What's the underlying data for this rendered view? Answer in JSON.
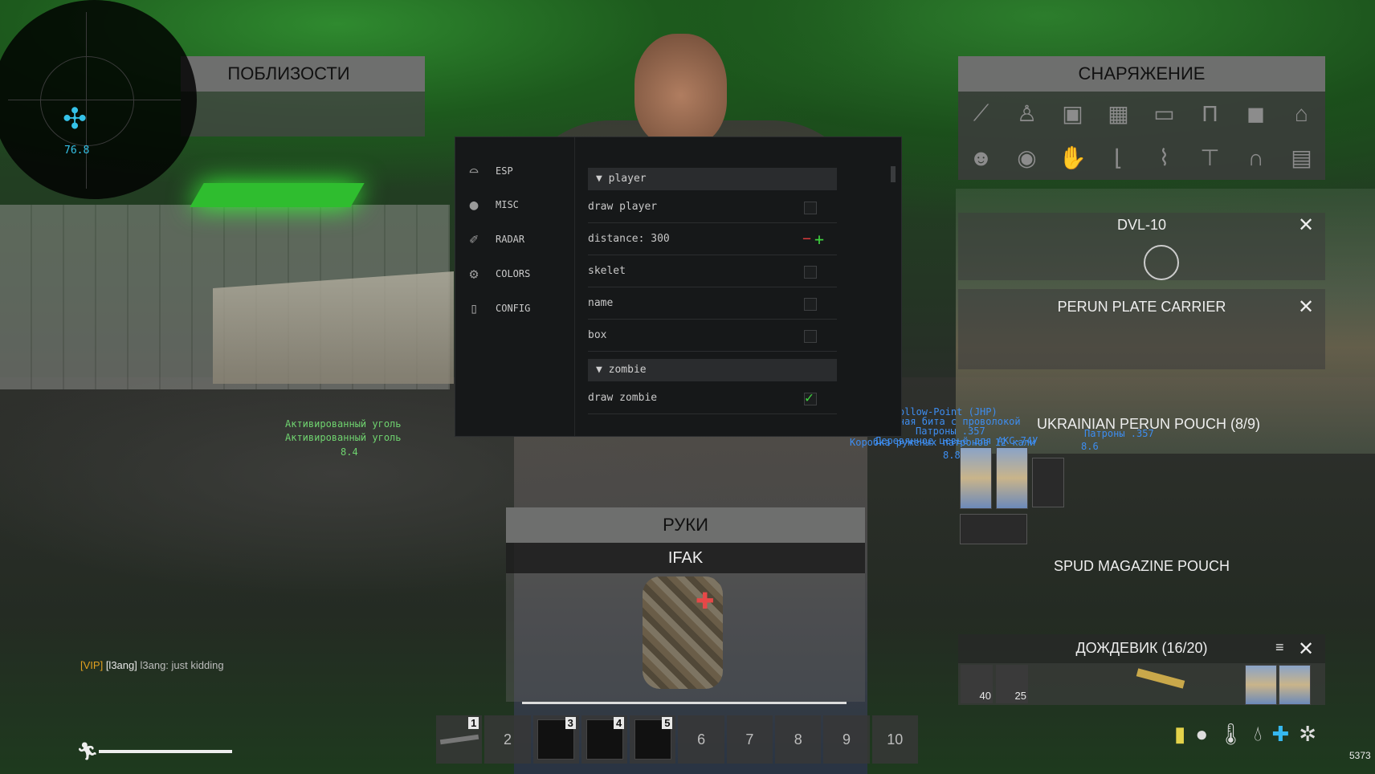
{
  "hud": {
    "radar_distance": "76.8",
    "nearby_title": "ПОБЛИЗОСТИ",
    "gear_title": "СНАРЯЖЕНИЕ",
    "hands_title": "РУКИ",
    "hands_item": "IFAK",
    "money": "5373"
  },
  "menu": {
    "tabs": [
      {
        "label": "ESP",
        "icon": "glasses-icon"
      },
      {
        "label": "MISC",
        "icon": "grenade-icon"
      },
      {
        "label": "RADAR",
        "icon": "pin-icon"
      },
      {
        "label": "COLORS",
        "icon": "gears-icon"
      },
      {
        "label": "CONFIG",
        "icon": "file-icon"
      }
    ],
    "sections": {
      "player": "player",
      "zombie": "zombie"
    },
    "options": {
      "draw_player": "draw player",
      "distance": "distance: 300",
      "skelet": "skelet",
      "name": "name",
      "box": "box",
      "draw_zombie": "draw zombie"
    },
    "checked": {
      "draw_zombie": true
    }
  },
  "inventory": {
    "weapon": "DVL-10",
    "vest": "PERUN PLATE CARRIER",
    "pouch1": "UKRAINIAN PERUN POUCH (8/9)",
    "pouch2": "SPUD MAGAZINE POUCH",
    "raincoat": "ДОЖДЕВИК (16/20)",
    "stack_counts": [
      "40",
      "25"
    ]
  },
  "world_labels": {
    "coal1": "Активированный уголь",
    "coal2": "Активированный уголь",
    "coal_dist": "8.4",
    "loot_lines": [
      "mm Hollow-Point (JHP)",
      "Сольная бита с проволокой",
      "Патроны .357",
      "Деревянное цевьё для АКС-74У",
      "Патроны .357",
      "Коробка руженых патронов 12 кали"
    ],
    "loot_dist1": "8.8",
    "loot_dist2": "8.6"
  },
  "chat": {
    "tag": "[VIP]",
    "user": "[l3ang]",
    "message": "l3ang: just kidding"
  },
  "hotbar": [
    "1",
    "2",
    "3",
    "4",
    "5",
    "6",
    "7",
    "8",
    "9",
    "10"
  ],
  "colors": {
    "radar_blip": "#35c2e8",
    "loot_text": "#3d8df0",
    "world_text": "#6fd36f",
    "vip_tag": "#e0a020",
    "checkbox_on": "#3fd13f"
  }
}
